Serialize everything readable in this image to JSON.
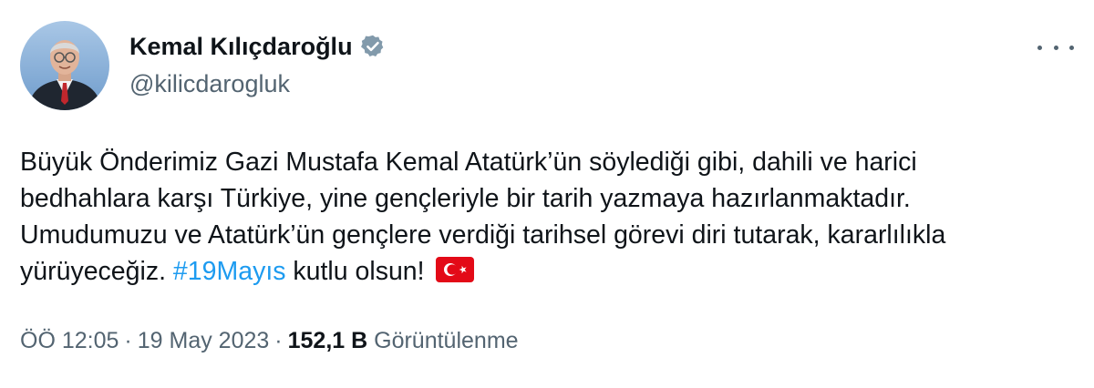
{
  "author": {
    "display_name": "Kemal Kılıçdaroğlu",
    "handle": "@kilicdarogluk",
    "verified_icon": "verified-badge-icon",
    "avatar_icon": "profile-photo"
  },
  "menu": {
    "icon": "more-horizontal-icon"
  },
  "tweet": {
    "text_before_hashtag": "Büyük Önderimiz Gazi Mustafa Kemal Atatürk’ün söylediği gibi, dahili ve harici bedhahlara karşı Türkiye, yine gençleriyle bir tarih yazmaya hazırlanmaktadır. Umudumuzu ve Atatürk’ün gençlere verdiği tarihsel görevi diri tutarak, kararlılıkla yürüyeceğiz. ",
    "hashtag": "#19Mayıs",
    "text_after_hashtag": " kutlu olsun!",
    "emoji_icon": "turkey-flag-icon"
  },
  "meta": {
    "time": "ÖÖ 12:05",
    "separator": "·",
    "date": "19 May 2023",
    "views_count": "152,1 B",
    "views_label": "Görüntülenme"
  },
  "colors": {
    "text": "#0f1419",
    "secondary": "#536471",
    "link": "#1d9bf0",
    "flag_red": "#e30a17",
    "verified": "#829aab"
  }
}
